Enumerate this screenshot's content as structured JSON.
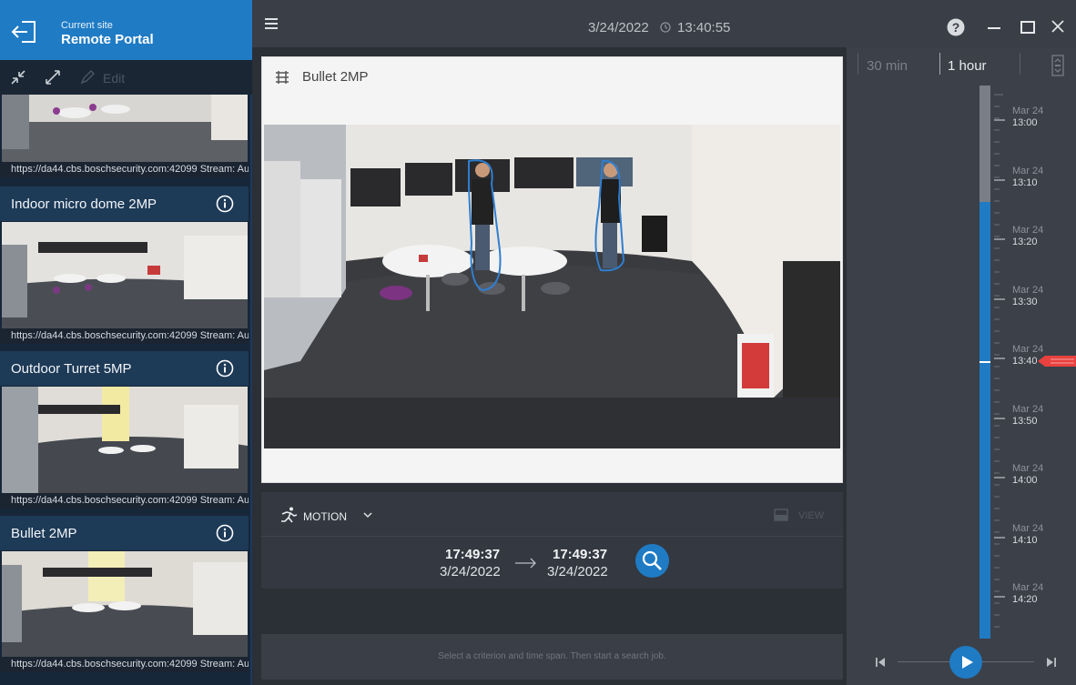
{
  "site": {
    "label": "Current site",
    "name": "Remote Portal"
  },
  "sidebar": {
    "edit_label": "Edit",
    "cameras": [
      {
        "title": "",
        "url": "https://da44.cbs.boschsecurity.com:42099 Stream: Au..."
      },
      {
        "title": "Indoor micro dome 2MP",
        "url": "https://da44.cbs.boschsecurity.com:42099 Stream: Au..."
      },
      {
        "title": "Outdoor Turret 5MP",
        "url": "https://da44.cbs.boschsecurity.com:42099 Stream: Au..."
      },
      {
        "title": "Bullet 2MP",
        "url": "https://da44.cbs.boschsecurity.com:42099 Stream: Au..."
      }
    ]
  },
  "topbar": {
    "date": "3/24/2022",
    "time": "13:40:55"
  },
  "video": {
    "title": "Bullet 2MP"
  },
  "search": {
    "criterion": "MOTION",
    "view_label": "VIEW",
    "start_time": "17:49:37",
    "start_date": "3/24/2022",
    "end_time": "17:49:37",
    "end_date": "3/24/2022"
  },
  "status": {
    "text": "Select a criterion and time span. Then start a search job."
  },
  "timeline": {
    "span_30min": "30 min",
    "span_1hour": "1 hour",
    "marks": [
      {
        "date": "Mar 24",
        "time": "13:00"
      },
      {
        "date": "Mar 24",
        "time": "13:10"
      },
      {
        "date": "Mar 24",
        "time": "13:20"
      },
      {
        "date": "Mar 24",
        "time": "13:30"
      },
      {
        "date": "Mar 24",
        "time": "13:40"
      },
      {
        "date": "Mar 24",
        "time": "13:50"
      },
      {
        "date": "Mar 24",
        "time": "14:00"
      },
      {
        "date": "Mar 24",
        "time": "14:10"
      },
      {
        "date": "Mar 24",
        "time": "14:20"
      }
    ],
    "current_time": "13:40",
    "colors": {
      "recorded": "#1f7bc4",
      "no_recording": "#7a7f87",
      "cursor": "#e8413f"
    }
  }
}
